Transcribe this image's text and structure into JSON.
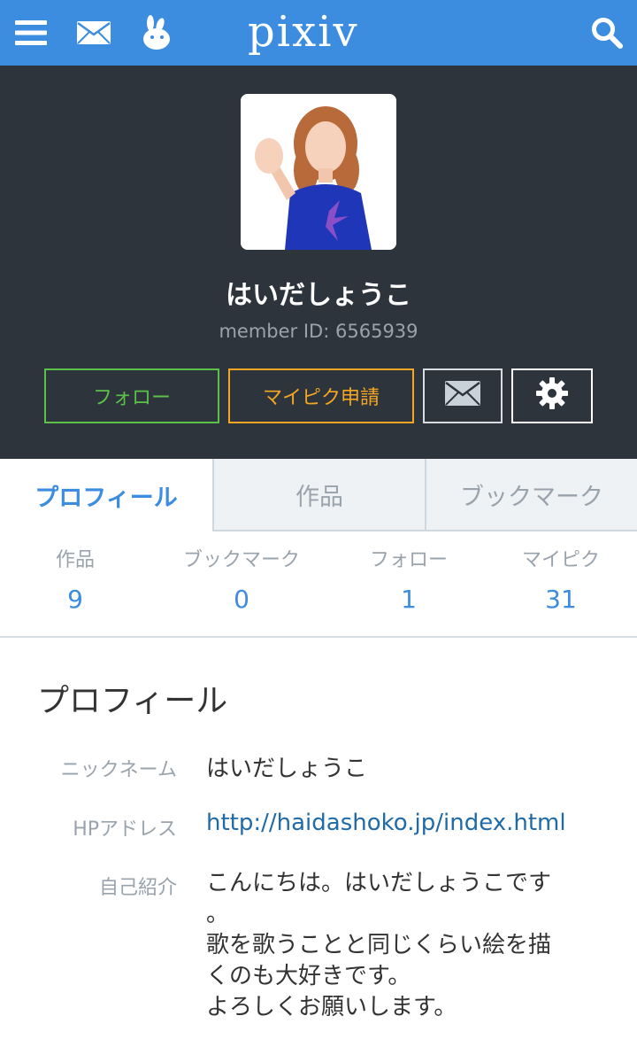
{
  "topbar": {
    "logo": "pixiv",
    "menu_icon": "hamburger-menu-icon",
    "mail_icon": "envelope-icon",
    "rabbit_icon": "rabbit-icon",
    "search_icon": "search-icon",
    "background": "#3c8ce0"
  },
  "profile": {
    "name": "はいだしょうこ",
    "member_id_label": "member ID:",
    "member_id": "6565939",
    "avatar_icon": "user-avatar"
  },
  "actions": {
    "follow": "フォロー",
    "mypick": "マイピク申請",
    "message_icon": "envelope-icon",
    "settings_icon": "gear-icon"
  },
  "tabs": [
    {
      "label": "プロフィール",
      "active": true
    },
    {
      "label": "作品",
      "active": false
    },
    {
      "label": "ブックマーク",
      "active": false
    }
  ],
  "stats": [
    {
      "label": "作品",
      "value": "9"
    },
    {
      "label": "ブックマーク",
      "value": "0"
    },
    {
      "label": "フォロー",
      "value": "1"
    },
    {
      "label": "マイピク",
      "value": "31"
    }
  ],
  "details": {
    "title": "プロフィール",
    "nickname_label": "ニックネーム",
    "nickname": "はいだしょうこ",
    "hp_label": "HPアドレス",
    "hp_url": "http://haidashoko.jp/index.html",
    "intro_label": "自己紹介",
    "intro_text": "こんにちは。はいだしょうこです\n。\n歌を歌うことと同じくらい絵を描\nくのも大好きです。\nよろしくお願いします。"
  },
  "colors": {
    "header_bg": "#2e343b",
    "accent_blue": "#3c8ce0",
    "follow_green": "#5cc14a",
    "mypick_orange": "#f5a623"
  }
}
